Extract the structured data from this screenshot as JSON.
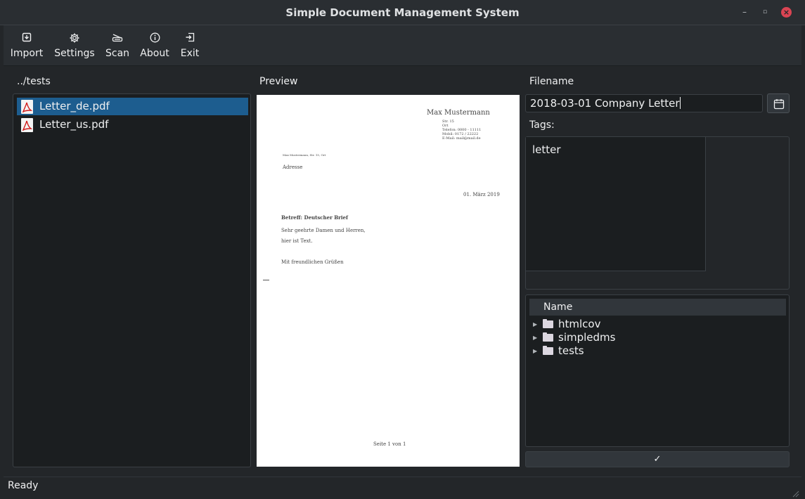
{
  "window": {
    "title": "Simple Document Management System",
    "controls": {
      "minimize": "–",
      "maximize": "▫",
      "close": "×"
    }
  },
  "toolbar": {
    "import_label": "Import",
    "settings_label": "Settings",
    "scan_label": "Scan",
    "about_label": "About",
    "exit_label": "Exit"
  },
  "files": {
    "path": "../tests",
    "items": [
      {
        "name": "Letter_de.pdf",
        "selected": true
      },
      {
        "name": "Letter_us.pdf",
        "selected": false
      }
    ]
  },
  "preview": {
    "label": "Preview",
    "document": {
      "sender_name": "Max Mustermann",
      "sender_details": [
        "Str. 15",
        "Ort",
        "Telefon: 0000 - 11111",
        "Mobil: 0172 / 22222",
        "E-Mail: mail@mail.de"
      ],
      "return_line": "Max Mustermann, Str. 15, Ort",
      "address": "Adresse",
      "date": "01. März 2019",
      "subject": "Betreff: Deutscher Brief",
      "salutation": "Sehr geehrte Damen und Herren,",
      "body": "hier ist Text.",
      "closing": "Mit freundlichen Grüßen",
      "footer": "Seite 1 von 1"
    }
  },
  "filename": {
    "label": "Filename",
    "value": "2018-03-01 Company Letter"
  },
  "tags": {
    "label": "Tags:",
    "value": "letter"
  },
  "tree": {
    "header": "Name",
    "folders": [
      "htmlcov",
      "simpledms",
      "tests"
    ]
  },
  "confirm": {
    "label": "✓"
  },
  "status": {
    "text": "Ready"
  },
  "colors": {
    "background": "#232629",
    "panel": "#1b1e20",
    "selection": "#1d5d8f",
    "close_button": "#da4453"
  }
}
